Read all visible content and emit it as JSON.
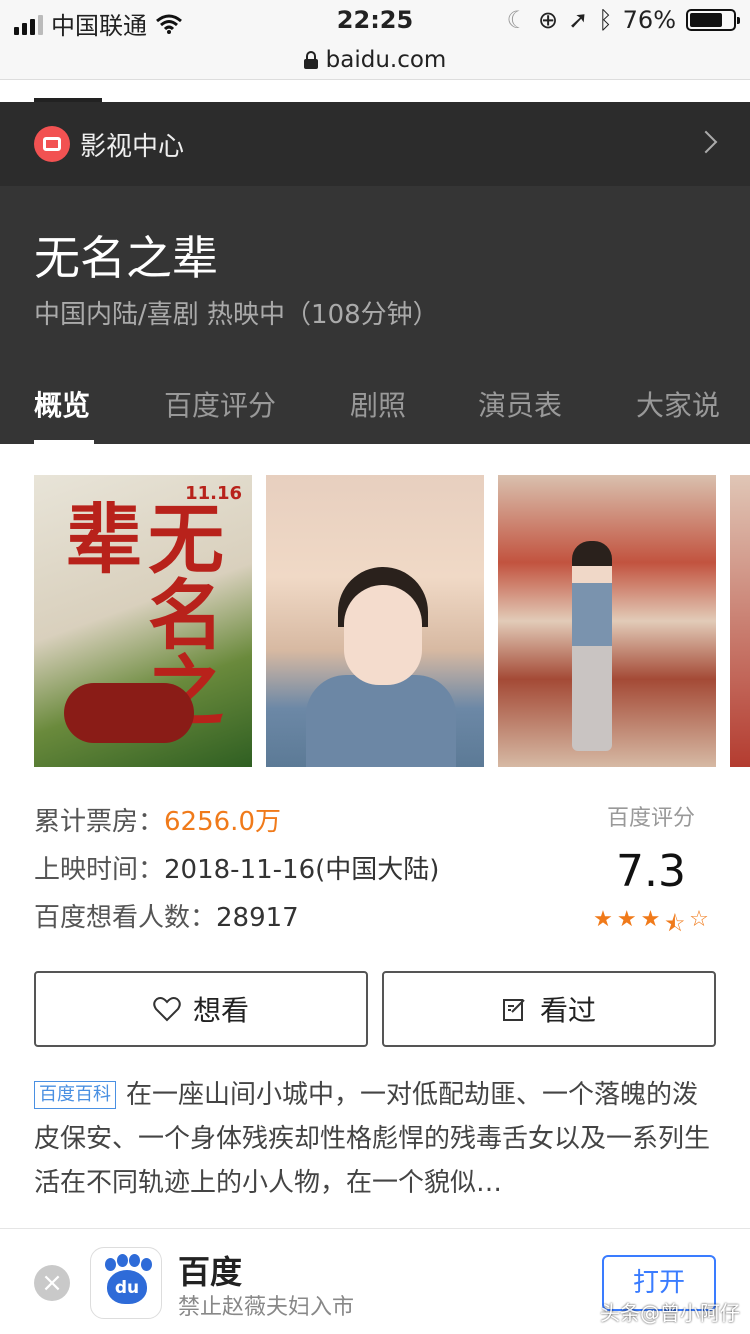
{
  "status_bar": {
    "carrier": "中国联通",
    "time": "22:25",
    "battery": "76%",
    "battery_level": 0.76
  },
  "url_bar": {
    "domain": "baidu.com"
  },
  "section": {
    "title": "影视中心"
  },
  "movie": {
    "title": "无名之辈",
    "meta": "中国内陆/喜剧  热映中（108分钟）"
  },
  "tabs": [
    {
      "label": "概览",
      "active": true
    },
    {
      "label": "百度评分"
    },
    {
      "label": "剧照"
    },
    {
      "label": "演员表"
    },
    {
      "label": "大家说"
    }
  ],
  "poster": {
    "date": "11.16",
    "title": "无名之辈"
  },
  "info": {
    "box_office_label": "累计票房：",
    "box_office_value": "6256.0万",
    "release_label": "上映时间：",
    "release_value": "2018-11-16(中国大陆)",
    "want_label": "百度想看人数：",
    "want_value": "28917"
  },
  "rating": {
    "label": "百度评分",
    "score": "7.3",
    "stars": 3.5
  },
  "buttons": {
    "want": "想看",
    "seen": "看过"
  },
  "description": {
    "badge": "百度百科",
    "text": "在一座山间小城中，一对低配劫匪、一个落魄的泼皮保安、一个身体残疾却性格彪悍的残毒舌女以及一系列生活在不同轨迹上的小人物，在一个貌似…"
  },
  "banner": {
    "app_name": "百度",
    "subtitle": "禁止赵薇夫妇入市",
    "open": "打开",
    "logo_text": "du"
  },
  "watermark": "头条@曾小阿仔",
  "icons": [
    "wifi-icon",
    "lock-icon",
    "tv-icon",
    "chevron-right-icon",
    "heart-icon",
    "edit-icon",
    "close-icon",
    "baidu-paw-icon"
  ]
}
